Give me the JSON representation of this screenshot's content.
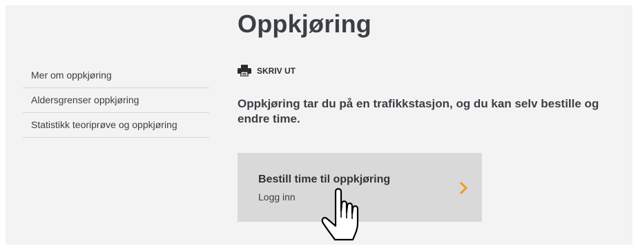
{
  "page": {
    "title": "Oppkjøring"
  },
  "sidebar": {
    "items": [
      {
        "label": "Mer om oppkjøring"
      },
      {
        "label": "Aldersgrenser oppkjøring"
      },
      {
        "label": "Statistikk teoriprøve og oppkjøring"
      }
    ]
  },
  "toolbar": {
    "print_label": "SKRIV UT",
    "print_icon": "printer-icon"
  },
  "main": {
    "lead": "Oppkjøring tar du på en trafikkstasjon, og du kan selv bestille og endre time.",
    "cta": {
      "title": "Bestill time til oppkjøring",
      "subtitle": "Logg inn",
      "icon": "chevron-right-icon"
    }
  },
  "colors": {
    "background": "#f3f3f3",
    "cta_background": "#d9d9d9",
    "accent": "#f29a1c",
    "text": "#3b3f44"
  },
  "cursor": {
    "icon": "hand-pointer-icon"
  }
}
